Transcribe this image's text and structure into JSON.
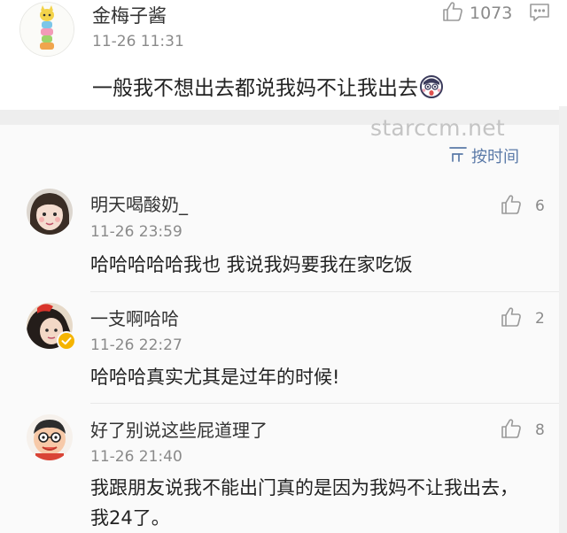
{
  "top_comment": {
    "username": "金梅子酱",
    "time": "11-26 11:31",
    "text": "一般我不想出去都说我妈不让我出去",
    "like_count": "1073",
    "icons": {
      "like": "thumbs-up-icon",
      "reply": "comment-icon",
      "emoji": "shocked-face-emoji-icon"
    }
  },
  "watermark": "starccm.net",
  "sort": {
    "label": "按时间",
    "icon": "sort-lines-icon"
  },
  "replies": [
    {
      "name": "明天喝酸奶_",
      "time": "11-26 23:59",
      "text": "哈哈哈哈哈我也 我说我妈要我在家吃饭",
      "likes": "6"
    },
    {
      "name": "一支啊哈哈",
      "time": "11-26 22:27",
      "text": "哈哈哈真实尤其是过年的时候!",
      "likes": "2",
      "verified": true
    },
    {
      "name": "好了别说这些屁道理了",
      "time": "11-26 21:40",
      "text": "我跟朋友说我不能出门真的是因为我妈不让我出去，我24了。",
      "likes": "8"
    }
  ],
  "colors": {
    "link_blue": "#5b7aa8",
    "muted_gray": "#8a8a8a",
    "badge_yellow": "#f5b400"
  }
}
